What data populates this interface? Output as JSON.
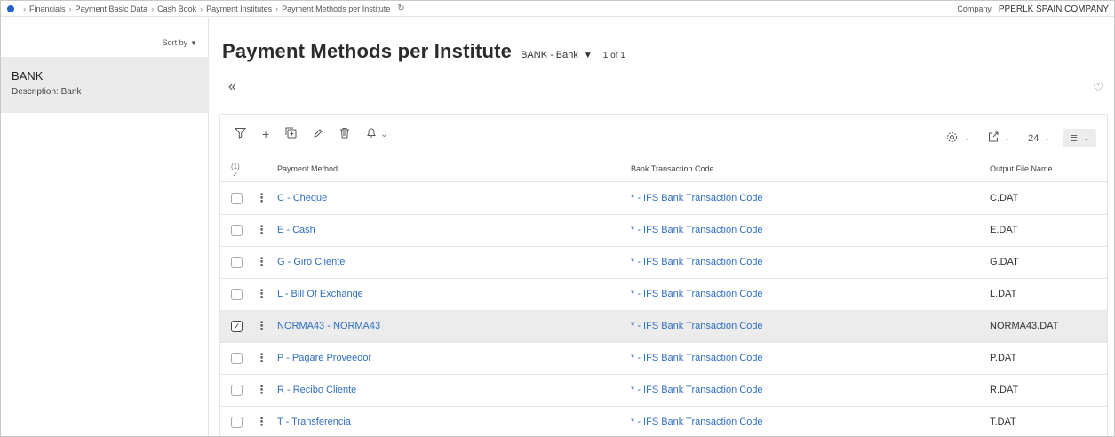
{
  "breadcrumb": {
    "items": [
      "Financials",
      "Payment Basic Data",
      "Cash Book",
      "Payment Institutes",
      "Payment Methods per Institute"
    ]
  },
  "company": {
    "label": "Company",
    "value": "PPERLK SPAIN COMPANY"
  },
  "left_panel": {
    "sort_label": "Sort by",
    "record": {
      "title": "BANK",
      "description_label": "Description:",
      "description_value": "Bank"
    }
  },
  "page": {
    "title": "Payment Methods per Institute",
    "context": "BANK - Bank",
    "record_count": "1 of 1"
  },
  "toolbar": {
    "page_size": "24"
  },
  "grid": {
    "selection_count": "(1)",
    "columns": {
      "payment_method": "Payment Method",
      "bank_transaction_code": "Bank Transaction Code",
      "output_file_name": "Output File Name"
    },
    "rows": [
      {
        "payment_method": "C - Cheque",
        "bank_transaction_code": "* - IFS Bank Transaction Code",
        "output_file_name": "C.DAT",
        "selected": false
      },
      {
        "payment_method": "E - Cash",
        "bank_transaction_code": "* - IFS Bank Transaction Code",
        "output_file_name": "E.DAT",
        "selected": false
      },
      {
        "payment_method": "G - Giro Cliente",
        "bank_transaction_code": "* - IFS Bank Transaction Code",
        "output_file_name": "G.DAT",
        "selected": false
      },
      {
        "payment_method": "L - Bill Of Exchange",
        "bank_transaction_code": "* - IFS Bank Transaction Code",
        "output_file_name": "L.DAT",
        "selected": false
      },
      {
        "payment_method": "NORMA43 - NORMA43",
        "bank_transaction_code": "* - IFS Bank Transaction Code",
        "output_file_name": "NORMA43.DAT",
        "selected": true
      },
      {
        "payment_method": "P - Pagaré Proveedor",
        "bank_transaction_code": "* - IFS Bank Transaction Code",
        "output_file_name": "P.DAT",
        "selected": false
      },
      {
        "payment_method": "R - Recibo Cliente",
        "bank_transaction_code": "* - IFS Bank Transaction Code",
        "output_file_name": "R.DAT",
        "selected": false
      },
      {
        "payment_method": "T - Transferencia",
        "bank_transaction_code": "* - IFS Bank Transaction Code",
        "output_file_name": "T.DAT",
        "selected": false
      }
    ]
  },
  "colors": {
    "link": "#2f6fbf",
    "accent": "#1f63c9",
    "selected_row": "#ececec"
  }
}
